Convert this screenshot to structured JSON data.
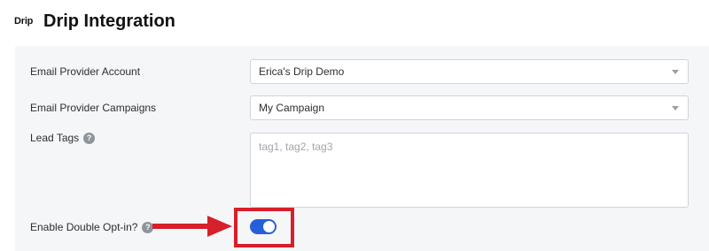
{
  "header": {
    "logo_text": "Drip",
    "title": "Drip Integration"
  },
  "form": {
    "account": {
      "label": "Email Provider Account",
      "value": "Erica's Drip Demo"
    },
    "campaigns": {
      "label": "Email Provider Campaigns",
      "value": "My Campaign"
    },
    "lead_tags": {
      "label": "Lead Tags",
      "placeholder": "tag1, tag2, tag3",
      "help_glyph": "?"
    },
    "double_optin": {
      "label": "Enable Double Opt-in?",
      "help_glyph": "?",
      "enabled": true
    }
  },
  "annotation": {
    "arrow_color": "#d6202b",
    "highlight_color": "#d6202b"
  },
  "colors": {
    "toggle_on": "#2560d8",
    "panel_bg": "#f5f6f8"
  }
}
